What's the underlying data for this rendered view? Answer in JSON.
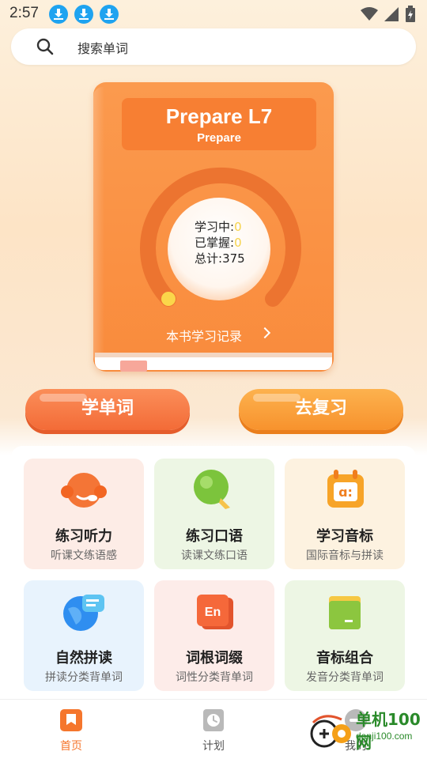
{
  "status_bar": {
    "time": "2:57"
  },
  "search": {
    "placeholder": "搜索单词"
  },
  "book": {
    "title": "Prepare L7",
    "subtitle": "Prepare",
    "learning_label": "学习中:",
    "learning_value": "0",
    "mastered_label": "已掌握:",
    "mastered_value": "0",
    "total_label": "总计:",
    "total_value": "375",
    "record_link": "本书学习记录"
  },
  "actions": {
    "learn": "学单词",
    "review": "去复习"
  },
  "features": [
    {
      "title": "练习听力",
      "subtitle": "听课文练语感",
      "icon": "headset-icon",
      "bg": "#fdece6"
    },
    {
      "title": "练习口语",
      "subtitle": "读课文练口语",
      "icon": "microphone-icon",
      "bg": "#edf6e4"
    },
    {
      "title": "学习音标",
      "subtitle": "国际音标与拼读",
      "icon": "phonetic-calendar-icon",
      "bg": "#fdf2e0"
    },
    {
      "title": "自然拼读",
      "subtitle": "拼读分类背单词",
      "icon": "globe-chat-icon",
      "bg": "#e8f3fd"
    },
    {
      "title": "词根词缀",
      "subtitle": "词性分类背单词",
      "icon": "en-card-icon",
      "bg": "#fdece9"
    },
    {
      "title": "音标组合",
      "subtitle": "发音分类背单词",
      "icon": "folder-icon",
      "bg": "#edf6e4"
    }
  ],
  "nav": {
    "items": [
      {
        "label": "首页",
        "active": true
      },
      {
        "label": "计划",
        "active": false
      },
      {
        "label": "我的",
        "active": false
      }
    ]
  },
  "watermark": {
    "line1": "单机100网",
    "line2": "danji100.com"
  },
  "colors": {
    "accent": "#f5762d",
    "highlight": "#f6d34b",
    "inactive": "#555555"
  }
}
